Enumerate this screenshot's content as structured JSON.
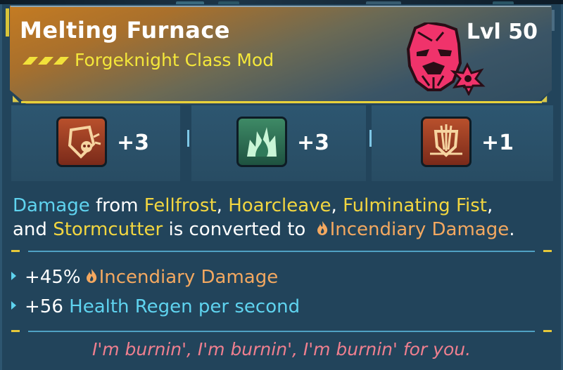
{
  "item": {
    "name": "Melting Furnace",
    "type": "Forgeknight Class Mod",
    "level": "Lvl 50",
    "rarity_color": "#c47b22",
    "portrait_icon": "forgeknight-portrait-icon"
  },
  "skills": [
    {
      "icon": "shield-skull-skill-icon",
      "value": "+3",
      "color": "#b34a2a"
    },
    {
      "icon": "green-flame-skill-icon",
      "value": "+3",
      "color": "#2f7a5a"
    },
    {
      "icon": "shield-spears-skill-icon",
      "value": "+1",
      "color": "#b34a2a"
    }
  ],
  "description": {
    "w1": "Damage",
    "w2": " from ",
    "w3": "Fellfrost",
    "w4": ", ",
    "w5": "Hoarcleave",
    "w6": ", ",
    "w7": "Fulminating Fist",
    "w8": ",",
    "w9": "and ",
    "w10": "Stormcutter",
    "w11": " is converted to ",
    "w12": "Incendiary Damage",
    "w13": "."
  },
  "stats": [
    {
      "prefix": "+45%",
      "label": "Incendiary Damage"
    },
    {
      "prefix": "+56",
      "label": "Health Regen per second"
    }
  ],
  "flavor": "I'm burnin', I'm burnin', I'm burnin' for you.",
  "colors": {
    "keyword_blue": "#5fd3ef",
    "skill_yellow": "#f2d640",
    "incendiary_orange": "#f3a860",
    "flavor_pink": "#ef7f8f"
  }
}
